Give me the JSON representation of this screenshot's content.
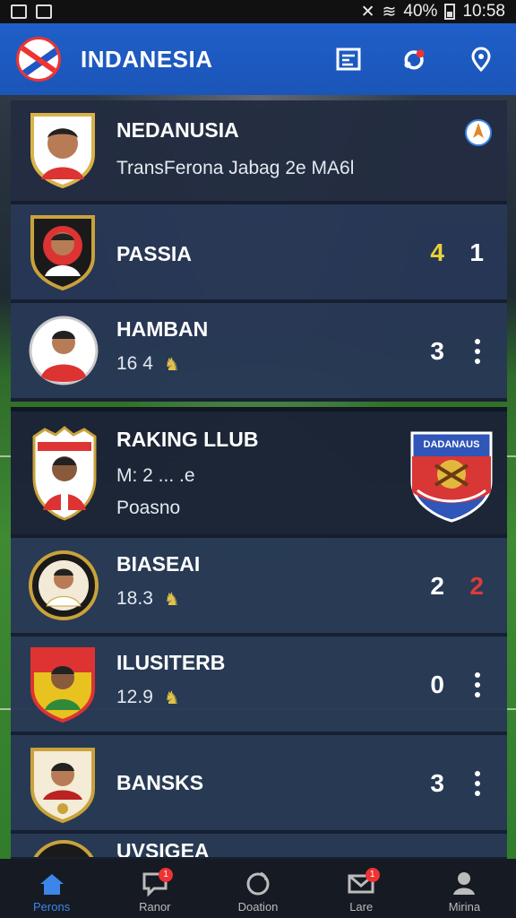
{
  "status_bar": {
    "battery": "40%",
    "time": "10:58"
  },
  "header": {
    "title": "INDANESIA"
  },
  "top_card": {
    "name": "NEDANUSIA",
    "subtitle": "TransFerona Jabag 2e MA6l"
  },
  "rows": [
    {
      "name": "PASSIA",
      "score_a": "4",
      "score_b": "1"
    },
    {
      "name": "HAMBAN",
      "stat": "16 4",
      "score": "3"
    },
    {
      "name": "RAKING LLUB",
      "line1": "M: 2 ... .e",
      "line2": "Poasno",
      "crest_text": "DADANAUS"
    },
    {
      "name": "BIASEAI",
      "stat": "18.3",
      "score_a": "2",
      "score_b": "2"
    },
    {
      "name": "ILUSITERB",
      "stat": "12.9",
      "score": "0"
    },
    {
      "name": "BANSKS",
      "score": "3"
    },
    {
      "name": "UVSIGEA"
    }
  ],
  "bottom_nav": [
    {
      "label": "Perons",
      "icon": "home-icon",
      "active": true
    },
    {
      "label": "Ranor",
      "icon": "chat-icon",
      "badge": "1"
    },
    {
      "label": "Doation",
      "icon": "ball-icon"
    },
    {
      "label": "Lare",
      "icon": "mail-icon",
      "badge": "1"
    },
    {
      "label": "Mirina",
      "icon": "person-icon"
    }
  ],
  "colors": {
    "accent": "#1f5fc8",
    "card": "#28375a",
    "nav_active": "#3b86e8",
    "badge": "#e33333",
    "highlight_yellow": "#e8d23a"
  }
}
